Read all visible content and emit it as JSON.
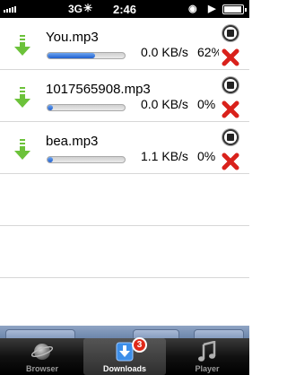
{
  "status_bar": {
    "carrier": "3G",
    "time": "2:46"
  },
  "downloads": [
    {
      "file_name": "You.mp3",
      "speed": "0.0 KB/s",
      "percent": "62%",
      "progress": 0.62
    },
    {
      "file_name": "1017565908.mp3",
      "speed": "0.0 KB/s",
      "percent": "0%",
      "progress": 0.0
    },
    {
      "file_name": "bea.mp3",
      "speed": "1.1 KB/s",
      "percent": "0%",
      "progress": 0.0
    }
  ],
  "tabs": [
    {
      "label": "Browser",
      "icon": "globe-icon",
      "active": false
    },
    {
      "label": "Downloads",
      "icon": "download-icon",
      "active": true,
      "badge": "3"
    },
    {
      "label": "Player",
      "icon": "music-note-icon",
      "active": false
    }
  ],
  "colors": {
    "progress_fill": "#1f5fcf",
    "download_arrow": "#6cc23a",
    "delete_x": "#d9211b",
    "badge": "#e02a1a",
    "toolbar_strip": "#7b93b8"
  }
}
